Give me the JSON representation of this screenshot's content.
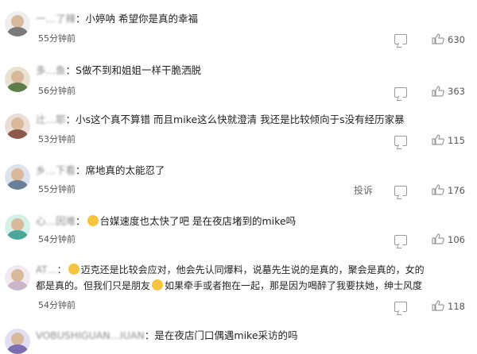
{
  "comments": [
    {
      "user": "一…了辣",
      "text": "小婷呐 希望你是真的幸福",
      "time": "55分钟前",
      "likes": "630",
      "avatar_color": "#7a7a7a"
    },
    {
      "user": "多…鱼",
      "text": "S做不到和姐姐一样干脆洒脱",
      "time": "56分钟前",
      "likes": "363",
      "avatar_color": "#5f7d4a"
    },
    {
      "user": "辻…耶",
      "text": "小s这个真不算错 而且mike这么快就澄清 我还是比较倾向于s没有经历家暴",
      "time": "53分钟前",
      "likes": "115",
      "avatar_color": "#8c5a4a"
    },
    {
      "user": "乡…下看",
      "text": "席地真的太能忍了",
      "time": "55分钟前",
      "likes": "176",
      "report": "投诉",
      "avatar_color": "#6a7f99"
    },
    {
      "user": "心…因难",
      "text": "台媒速度也太快了吧 是在夜店堵到的mike吗",
      "time": "54分钟前",
      "likes": "106",
      "avatar_color": "#4aa79a"
    },
    {
      "user": "AT…",
      "text_line1": "迈克还是比较会应对，他会先认同爆料，说墓先生说的是真的，聚会是真的，女的",
      "text_line2a": "都是真的。但我们只是朋友",
      "text_line2b": "如果牵手或者抱在一起，那是因为喝醉了我要扶她，绅士风度",
      "time": "54分钟前",
      "likes": "118",
      "avatar_color": "#c9b7c9"
    },
    {
      "user": "VOBUSHIGUAN…IUAN",
      "text": "是在夜店门口偶遇mike采访的吗",
      "avatar_color": "#7d6fb0"
    }
  ]
}
